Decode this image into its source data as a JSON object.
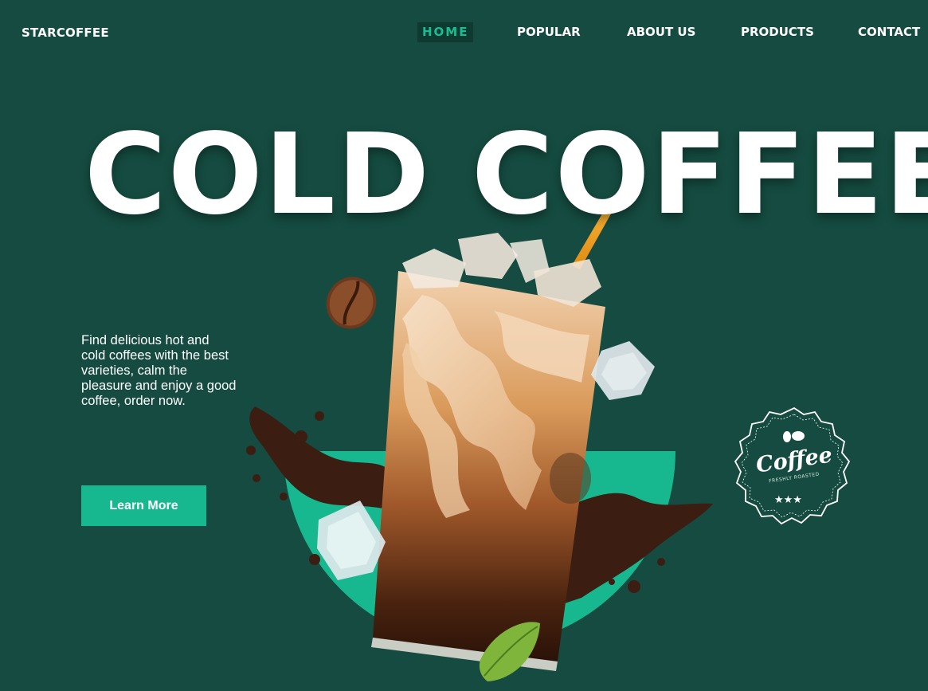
{
  "brand": "STARCOFFEE",
  "nav": {
    "items": [
      {
        "label": "HOME",
        "active": true
      },
      {
        "label": "POPULAR",
        "active": false
      },
      {
        "label": "ABOUT US",
        "active": false
      },
      {
        "label": "PRODUCTS",
        "active": false
      },
      {
        "label": "CONTACT",
        "active": false
      }
    ]
  },
  "hero": {
    "title": "COLD COFFEE",
    "tagline": "Find delicious hot and cold coffees with the best varieties, calm the pleasure and enjoy a good coffee, order now.",
    "cta_label": "Learn More"
  },
  "badge": {
    "word": "Coffee",
    "sub": "FRESHLY ROASTED"
  },
  "colors": {
    "background": "#154b40",
    "accent": "#17b890",
    "active_nav_bg": "#0f3a31",
    "active_nav_text": "#1cbc93",
    "text": "#ffffff"
  }
}
